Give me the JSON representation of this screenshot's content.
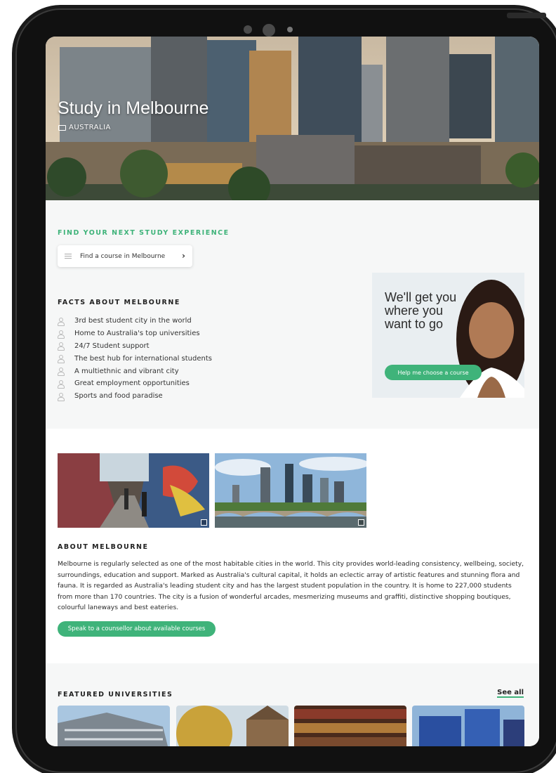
{
  "hero": {
    "title": "Study in Melbourne",
    "location": "AUSTRALIA"
  },
  "find": {
    "heading": "FIND YOUR NEXT STUDY EXPERIENCE",
    "button_label": "Find a course in Melbourne",
    "chevron": "›"
  },
  "facts": {
    "heading": "FACTS ABOUT MELBOURNE",
    "items": [
      "3rd best student city in the world",
      "Home to Australia's top universities",
      "24/7 Student support",
      "The best hub for international students",
      "A multiethnic and vibrant city",
      "Great employment opportunities",
      "Sports and food paradise"
    ]
  },
  "promo": {
    "text": "We'll get you where you want to go",
    "button_label": "Help me choose a course"
  },
  "about": {
    "heading": "ABOUT MELBOURNE",
    "body": "Melbourne is regularly selected as one of the most habitable cities in the world. This city provides world-leading consistency, wellbeing, society, surroundings, education and support. Marked as Australia's cultural capital, it holds an eclectic array of artistic features and stunning flora and fauna. It is regarded as Australia's leading student city and has the largest student population in the country. It is home to 227,000 students from more than 170 countries. The city is a fusion of wonderful arcades, mesmerizing museums and graffiti, distinctive shopping boutiques, colourful laneways and best eateries.",
    "button_label": "Speak to a counsellor about available courses"
  },
  "featured": {
    "heading": "FEATURED UNIVERSITIES",
    "see_all": "See all"
  },
  "colors": {
    "accent": "#3fb37a",
    "device": "#111111",
    "section_bg": "#f6f7f7"
  },
  "icons": [
    "flag-icon",
    "list-icon",
    "chevron-right-icon",
    "person-icon",
    "expand-icon"
  ]
}
